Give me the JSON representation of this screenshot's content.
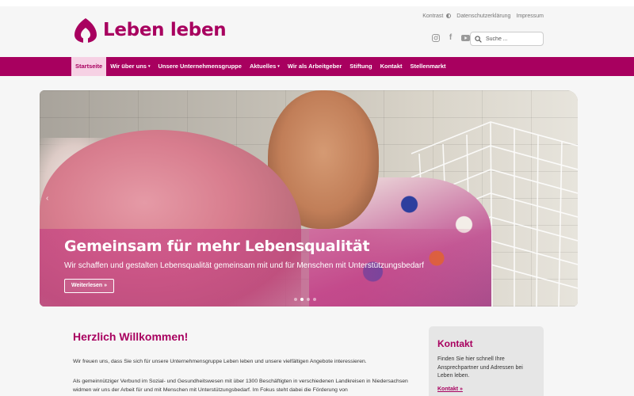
{
  "brand": {
    "name": "Leben leben",
    "color": "#a8005f"
  },
  "utility": {
    "contrast": "Kontrast",
    "privacy": "Datenschutzerklärung",
    "imprint": "Impressum"
  },
  "social": {
    "icons": [
      "instagram-icon",
      "facebook-icon",
      "youtube-icon"
    ],
    "facebook_glyph": "f"
  },
  "search": {
    "placeholder": "Suche ..."
  },
  "nav": {
    "items": [
      {
        "label": "Startseite",
        "active": true
      },
      {
        "label": "Wir über uns",
        "dropdown": true
      },
      {
        "label": "Unsere Unternehmensgruppe"
      },
      {
        "label": "Aktuelles",
        "dropdown": true
      },
      {
        "label": "Wir als Arbeitgeber"
      },
      {
        "label": "Stiftung"
      },
      {
        "label": "Kontakt"
      },
      {
        "label": "Stellenmarkt"
      }
    ],
    "caret": "▾"
  },
  "hero": {
    "title": "Gemeinsam für mehr Lebensqualität",
    "subtitle": "Wir schaffen und gestalten Lebensqualität gemeinsam mit und für Menschen mit Unterstützungsbedarf",
    "button": "Weiterlesen »",
    "prev_arrow": "‹",
    "slide_count": 4,
    "active_slide": 2
  },
  "main": {
    "heading": "Herzlich Willkommen!",
    "para1": "Wir freuen uns, dass Sie sich für unsere Unternehmensgruppe Leben leben und unsere vielfältigen Angebote interessieren.",
    "para2": "Als gemeinnütziger Verbund im Sozial- und Gesundheitswesen mit über 1300 Beschäftigten in verschiedenen Landkreisen in Niedersachsen widmen wir uns der Arbeit für und mit Menschen mit Unterstützungsbedarf. Im Fokus steht dabei die Förderung von"
  },
  "sidebar": {
    "title": "Kontakt",
    "text": "Finden Sie hier schnell Ihre Ansprechpartner und Adressen bei Leben leben.",
    "link": "Kontakt »"
  }
}
